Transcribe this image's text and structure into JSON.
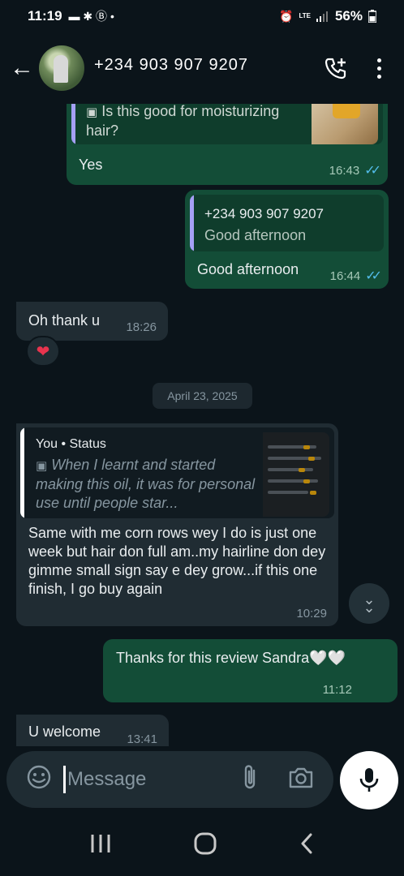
{
  "status_bar": {
    "time": "11:19",
    "notif_icons": "▬ ✱ Ⓑ •",
    "lte": "LTE",
    "battery": "56%"
  },
  "header": {
    "contact": "+234 903 907 9207"
  },
  "messages": [
    {
      "quote_text": "Is this good for moisturizing hair?",
      "text": "Yes",
      "time": "16:43",
      "ticks": "✓✓"
    },
    {
      "quote_sender": "+234 903 907 9207",
      "quote_text": "Good afternoon",
      "text": "Good afternoon",
      "time": "16:44",
      "ticks": "✓✓"
    },
    {
      "text": "Oh thank u",
      "time": "18:26",
      "reaction": "❤"
    }
  ],
  "date_chip": "April 23, 2025",
  "status_reply": {
    "quote_sender": "You",
    "quote_type": "Status",
    "quote_text": "When I learnt and started making this oil, it was for personal use until people star...",
    "text": "Same with me corn rows wey I do is just one week but hair don full am..my hairline don dey gimme small sign say e dey grow...if this one finish, I go buy again",
    "time": "10:29"
  },
  "thanks_msg": {
    "text": "Thanks for this review Sandra🤍🤍",
    "time": "11:12"
  },
  "welcome_msg": {
    "text": "U welcome",
    "time": "13:41"
  },
  "input": {
    "placeholder": "Message"
  },
  "colors": {
    "bg": "#0b141a",
    "outgoing": "#134d37",
    "incoming": "#202c33",
    "ticks": "#53bdeb",
    "quote_bar_self": "#a5a0f5",
    "quote_bar_status": "#ffffff"
  }
}
